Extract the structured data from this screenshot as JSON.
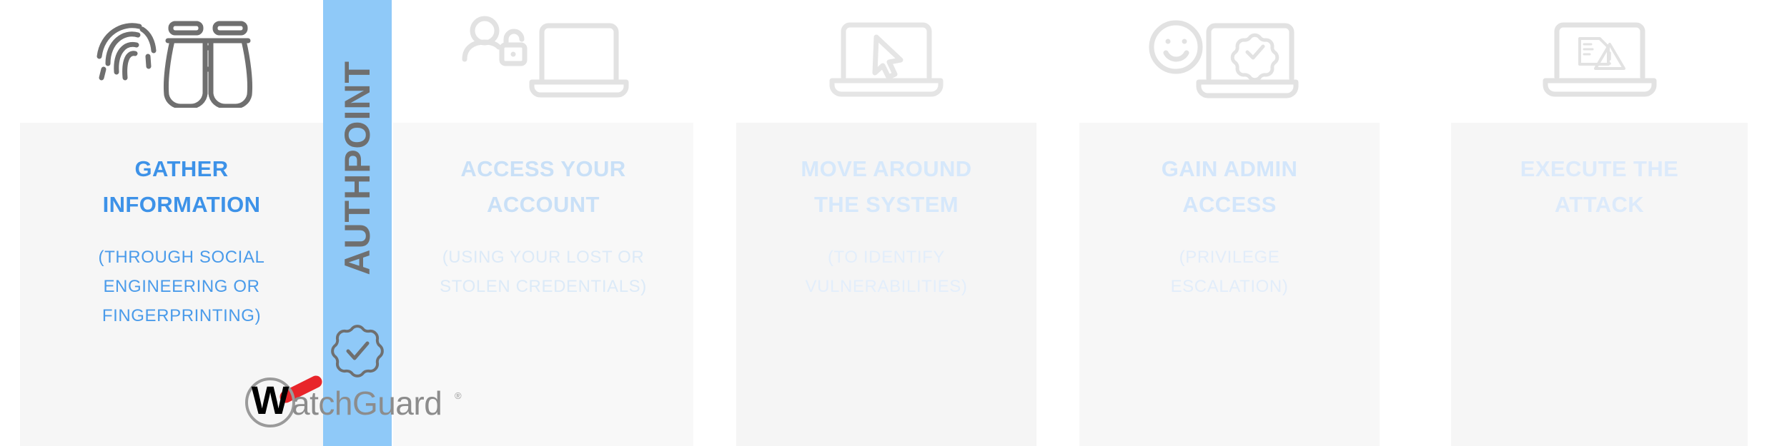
{
  "brand": {
    "authpoint_label": "AUTHPOINT",
    "authpoint_badge_icon": "authpoint-seal-check-icon",
    "logo_mark_letter": "W",
    "logo_wordmark": "atchGuard",
    "logo_registered": "®",
    "band_color": "#8FC9F8",
    "logo_accent_color": "#E8252A",
    "logo_text_color": "#8C8C8C"
  },
  "theme": {
    "page_background": "#FFFFFF",
    "card_background": "#F6F6F6",
    "title_color": "#3D92E8",
    "subtitle_color": "#4A9BEA",
    "icon_color_active": "#6F6F6F",
    "icon_color_faded": "#E2E2E2"
  },
  "steps": [
    {
      "index": 1,
      "title": "GATHER\nINFORMATION",
      "subtitle": "(THROUGH SOCIAL\nENGINEERING OR\nFINGERPRINTING)",
      "icon": "fingerprint-binoculars-icon",
      "state": "active"
    },
    {
      "index": 2,
      "title": "ACCESS YOUR\nACCOUNT",
      "subtitle": "(USING YOUR LOST OR\nSTOLEN CREDENTIALS)",
      "icon": "user-unlocked-padlock-laptop-icon",
      "state": "faded"
    },
    {
      "index": 3,
      "title": "MOVE AROUND\nTHE SYSTEM",
      "subtitle": "(TO IDENTIFY\nVULNERABILITIES)",
      "icon": "laptop-cursor-icon",
      "state": "faded"
    },
    {
      "index": 4,
      "title": "GAIN ADMIN\nACCESS",
      "subtitle": "(PRIVILEGE\nESCALATION)",
      "icon": "smiley-laptop-verified-badge-icon",
      "state": "faded"
    },
    {
      "index": 5,
      "title": "EXECUTE THE\nATTACK",
      "subtitle": "",
      "icon": "laptop-file-warning-icon",
      "state": "faded"
    }
  ]
}
